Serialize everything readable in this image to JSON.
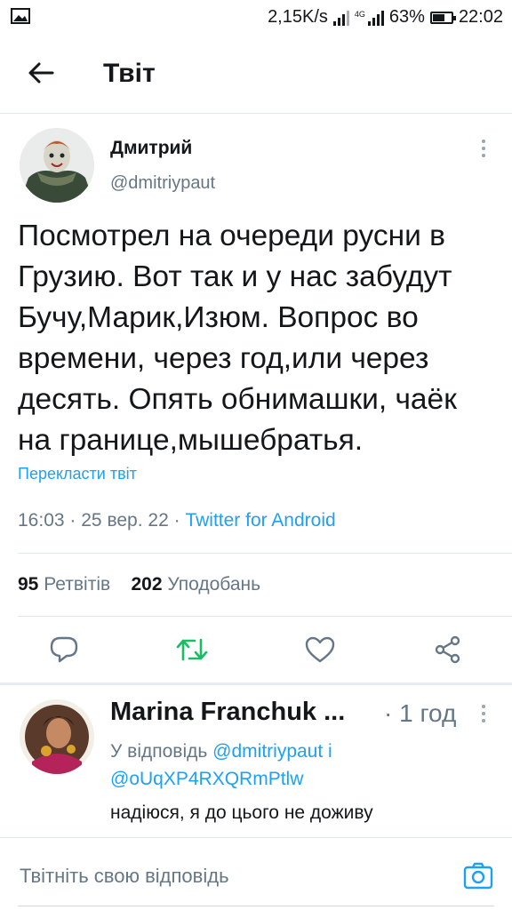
{
  "status_bar": {
    "net_speed": "2,15K/s",
    "network_type": "4G",
    "battery": "63%",
    "battery_level": 0.63,
    "time": "22:02",
    "icons": [
      "image-notification-icon",
      "signal-icon",
      "battery-icon"
    ]
  },
  "header": {
    "back_icon": "arrow-left-icon",
    "title": "Твіт"
  },
  "tweet": {
    "author_name": "Дмитрий",
    "author_handle": "@dmitriypaut",
    "text": "Посмотрел на очереди русни в Грузию. Вот так и у нас забудут Бучу,Марик,Изюм. Вопрос во времени, через год,или через десять. Опять обнимашки, чаёк на границе,мышебратья.",
    "translate_label": "Перекласти твіт",
    "time": "16:03",
    "separator": "·",
    "date": "25 вер. 22",
    "source": "Twitter for Android",
    "retweets_count": "95",
    "retweets_label": "Ретвітів",
    "likes_count": "202",
    "likes_label": "Уподобань"
  },
  "actions": [
    {
      "name": "reply",
      "icon": "comment-icon"
    },
    {
      "name": "retweet",
      "icon": "retweet-icon"
    },
    {
      "name": "like",
      "icon": "heart-icon"
    },
    {
      "name": "share",
      "icon": "share-icon"
    }
  ],
  "reply": {
    "author_name": "Marina Franchuk ...",
    "time": "· 1 год",
    "reply_prefix": "У відповідь",
    "mention_1": "@dmitriypaut",
    "conjunction": "і",
    "mention_2": "@oUqXP4RXQRmPtlw",
    "text": "надіюся, я до цього не доживу"
  },
  "compose": {
    "placeholder": "Твітніть свою відповідь",
    "camera_icon": "camera-icon"
  },
  "colors": {
    "accent": "#1da1f2",
    "retweet_green": "#17bf63",
    "text_primary": "#14171a",
    "text_secondary": "#657786",
    "divider": "#e1e8ed"
  }
}
